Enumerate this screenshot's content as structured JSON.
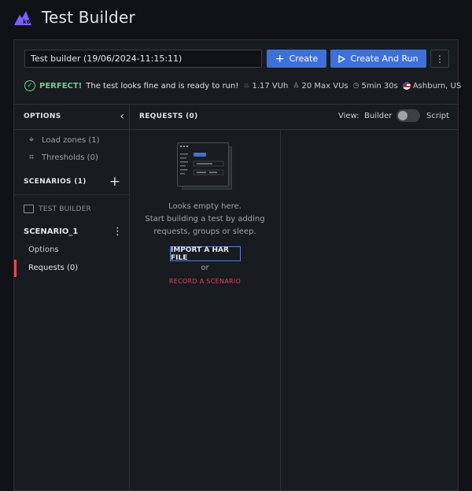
{
  "app": {
    "title": "Test Builder",
    "brand_color": "#7b61ff"
  },
  "toolbar": {
    "test_name_value": "Test builder (19/06/2024-11:15:11)",
    "create_label": "Create",
    "create_and_run_label": "Create And Run",
    "primary_color": "#3d71d9"
  },
  "status": {
    "badge": "PERFECT!",
    "message": "The test looks fine and is ready to run!",
    "vuh": "1.17 VUh",
    "max_vus": "20 Max VUs",
    "duration": "5min 30s",
    "location": "Ashburn, US",
    "ok_color": "#6ccf8e"
  },
  "sidebar": {
    "options_title": "OPTIONS",
    "items": [
      {
        "label": "Load zones (1)",
        "icon": "location-pin-icon"
      },
      {
        "label": "Thresholds (0)",
        "icon": "chart-icon"
      }
    ],
    "scenarios_title": "SCENARIOS (1)",
    "test_builder_label": "TEST BUILDER",
    "scenario_name": "SCENARIO_1",
    "scenario_options_label": "Options",
    "scenario_requests_label": "Requests (0)",
    "active_color": "#e64a4a"
  },
  "requests": {
    "title": "REQUESTS (0)",
    "view_label": "View:",
    "builder_label": "Builder",
    "script_label": "Script",
    "script_mode_on": false,
    "empty_line1": "Looks empty here.",
    "empty_line2": "Start building a test by adding",
    "empty_line3": "requests, groups or sleep.",
    "import_label": "IMPORT A HAR FILE",
    "or_label": "or",
    "record_label": "RECORD A SCENARIO"
  }
}
